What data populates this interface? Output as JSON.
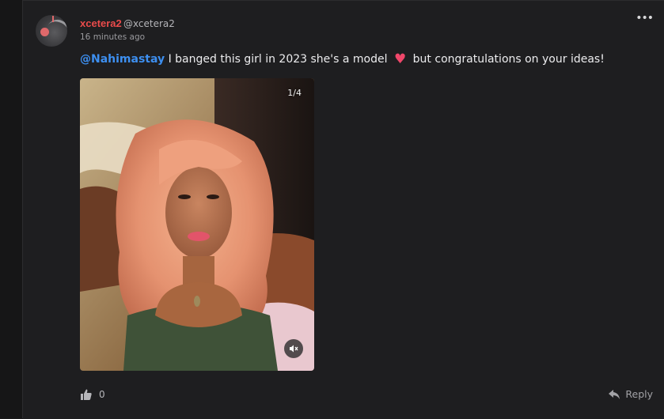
{
  "post": {
    "username": "xcetera2",
    "handle": "@xcetera2",
    "timestamp": "16 minutes ago",
    "comment": {
      "mention": "@Nahimastay",
      "text_before_emoji": "I banged this girl in 2023 she's a model",
      "emoji": "heart",
      "text_after_emoji": "but congratulations on your ideas!"
    },
    "media": {
      "counter": "1/4",
      "mute_icon": "speaker-muted-icon"
    },
    "likes": "0",
    "reply_label": "Reply",
    "more_icon": "more-horizontal-icon"
  },
  "colors": {
    "background": "#1e1e20",
    "username": "#ea4b4b",
    "mention": "#3d8ff0",
    "heart": "#f0476a",
    "text": "#ececee",
    "muted_text": "#9a9a9e"
  }
}
